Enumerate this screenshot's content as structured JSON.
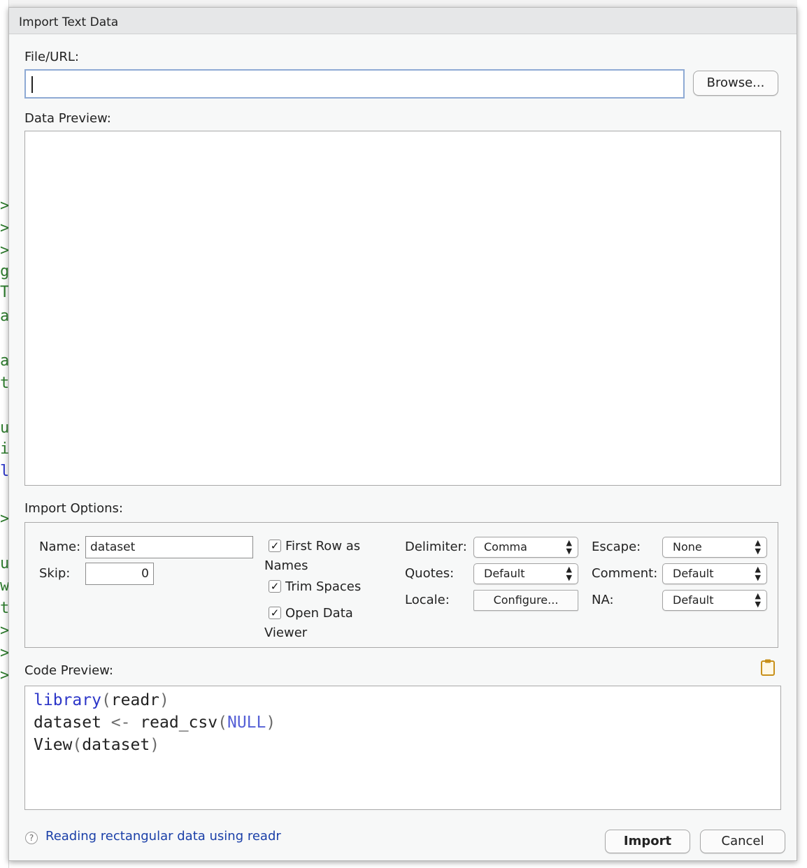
{
  "dialog": {
    "title": "Import Text Data"
  },
  "file": {
    "label": "File/URL:",
    "value": "",
    "browse_label": "Browse..."
  },
  "data_preview": {
    "label": "Data Preview:"
  },
  "import_options": {
    "label": "Import Options:",
    "name_label": "Name:",
    "name_value": "dataset",
    "skip_label": "Skip:",
    "skip_value": "0",
    "first_row_line1": "First Row as",
    "first_row_line2": "Names",
    "first_row_checked": true,
    "trim_spaces": "Trim Spaces",
    "trim_spaces_checked": true,
    "open_viewer_line1": "Open Data",
    "open_viewer_line2": "Viewer",
    "open_viewer_checked": true,
    "delimiter_label": "Delimiter:",
    "delimiter_value": "Comma",
    "quotes_label": "Quotes:",
    "quotes_value": "Default",
    "locale_label": "Locale:",
    "locale_button": "Configure...",
    "escape_label": "Escape:",
    "escape_value": "None",
    "comment_label": "Comment:",
    "comment_value": "Default",
    "na_label": "NA:",
    "na_value": "Default"
  },
  "code_preview": {
    "label": "Code Preview:",
    "line1_fn": "library",
    "line1_open": "(",
    "line1_arg": "readr",
    "line1_close": ")",
    "line2_var": "dataset ",
    "line2_op": "<-",
    "line2_fn": " read_csv",
    "line2_open": "(",
    "line2_arg": "NULL",
    "line2_close": ")",
    "line3_fn": "View",
    "line3_open": "(",
    "line3_arg": "dataset",
    "line3_close": ")"
  },
  "footer": {
    "help_icon": "?",
    "help_link": "Reading rectangular data using readr",
    "import_label": "Import",
    "cancel_label": "Cancel"
  },
  "background_glyphs": [
    ">",
    ">",
    ">",
    "g",
    "T",
    "a",
    "a",
    "t",
    "u",
    "i",
    "l",
    ">",
    "u",
    "w",
    "t",
    ">",
    ">",
    ">"
  ]
}
